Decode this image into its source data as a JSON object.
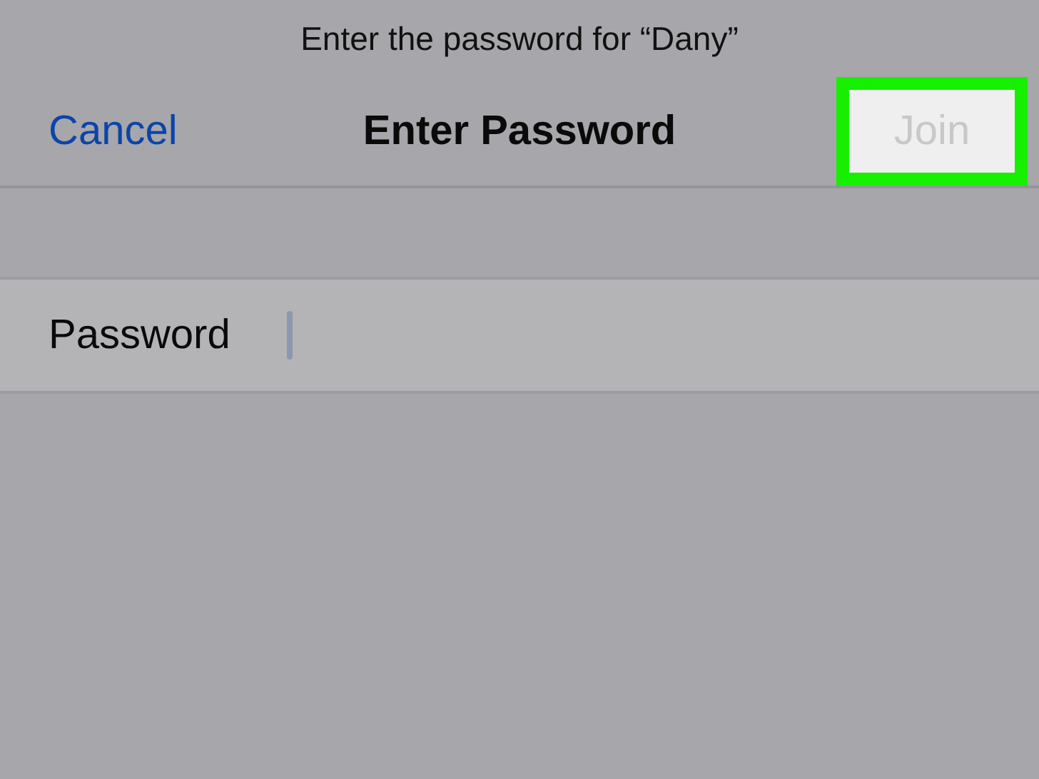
{
  "prompt": "Enter the password for “Dany”",
  "nav_bar": {
    "cancel": "Cancel",
    "title": "Enter Password",
    "join": {
      "label": "Join",
      "disabled": true,
      "highlighted": true
    }
  },
  "form": {
    "label": "Password",
    "focused": true
  }
}
